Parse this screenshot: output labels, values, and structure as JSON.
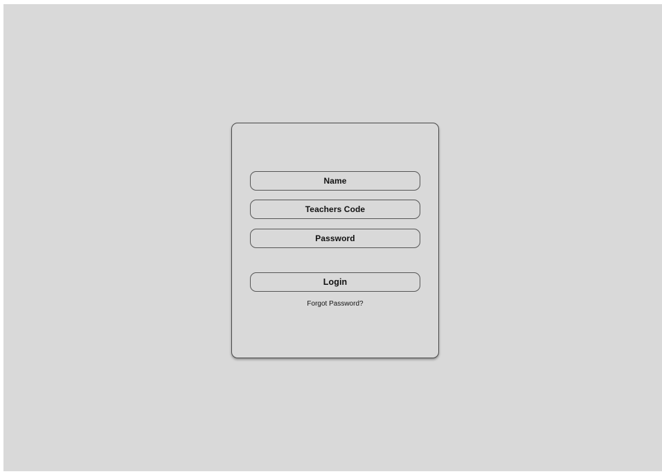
{
  "login_form": {
    "name_placeholder": "Name",
    "teachers_code_placeholder": "Teachers Code",
    "password_placeholder": "Password",
    "login_label": "Login",
    "forgot_password_label": "Forgot Password?"
  },
  "colors": {
    "background": "#d9d9d9",
    "border": "#4a4a4a",
    "text": "#111111"
  }
}
